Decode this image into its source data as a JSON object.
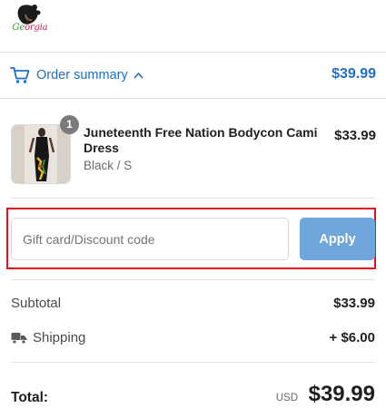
{
  "header": {
    "logo_text_g": "Ge",
    "logo_text_rest": "orgia"
  },
  "summary": {
    "toggle_label": "Order summary",
    "total": "$39.99"
  },
  "line_item": {
    "quantity": "1",
    "name": "Juneteenth Free Nation Bodycon Cami Dress",
    "variant": "Black / S",
    "price": "$33.99"
  },
  "discount": {
    "placeholder": "Gift card/Discount code",
    "value": "",
    "apply_label": "Apply"
  },
  "totals": {
    "subtotal_label": "Subtotal",
    "subtotal_value": "$33.99",
    "shipping_label": "Shipping",
    "shipping_value": "+ $6.00",
    "total_label": "Total:",
    "currency": "USD",
    "total_value": "$39.99"
  },
  "colors": {
    "accent": "#1f6fc5",
    "apply_button": "#6fa6dc",
    "highlight_outline": "#e0101b"
  },
  "icons": {
    "cart": "cart-icon",
    "chevron": "chevron-up-icon",
    "truck": "truck-icon"
  }
}
